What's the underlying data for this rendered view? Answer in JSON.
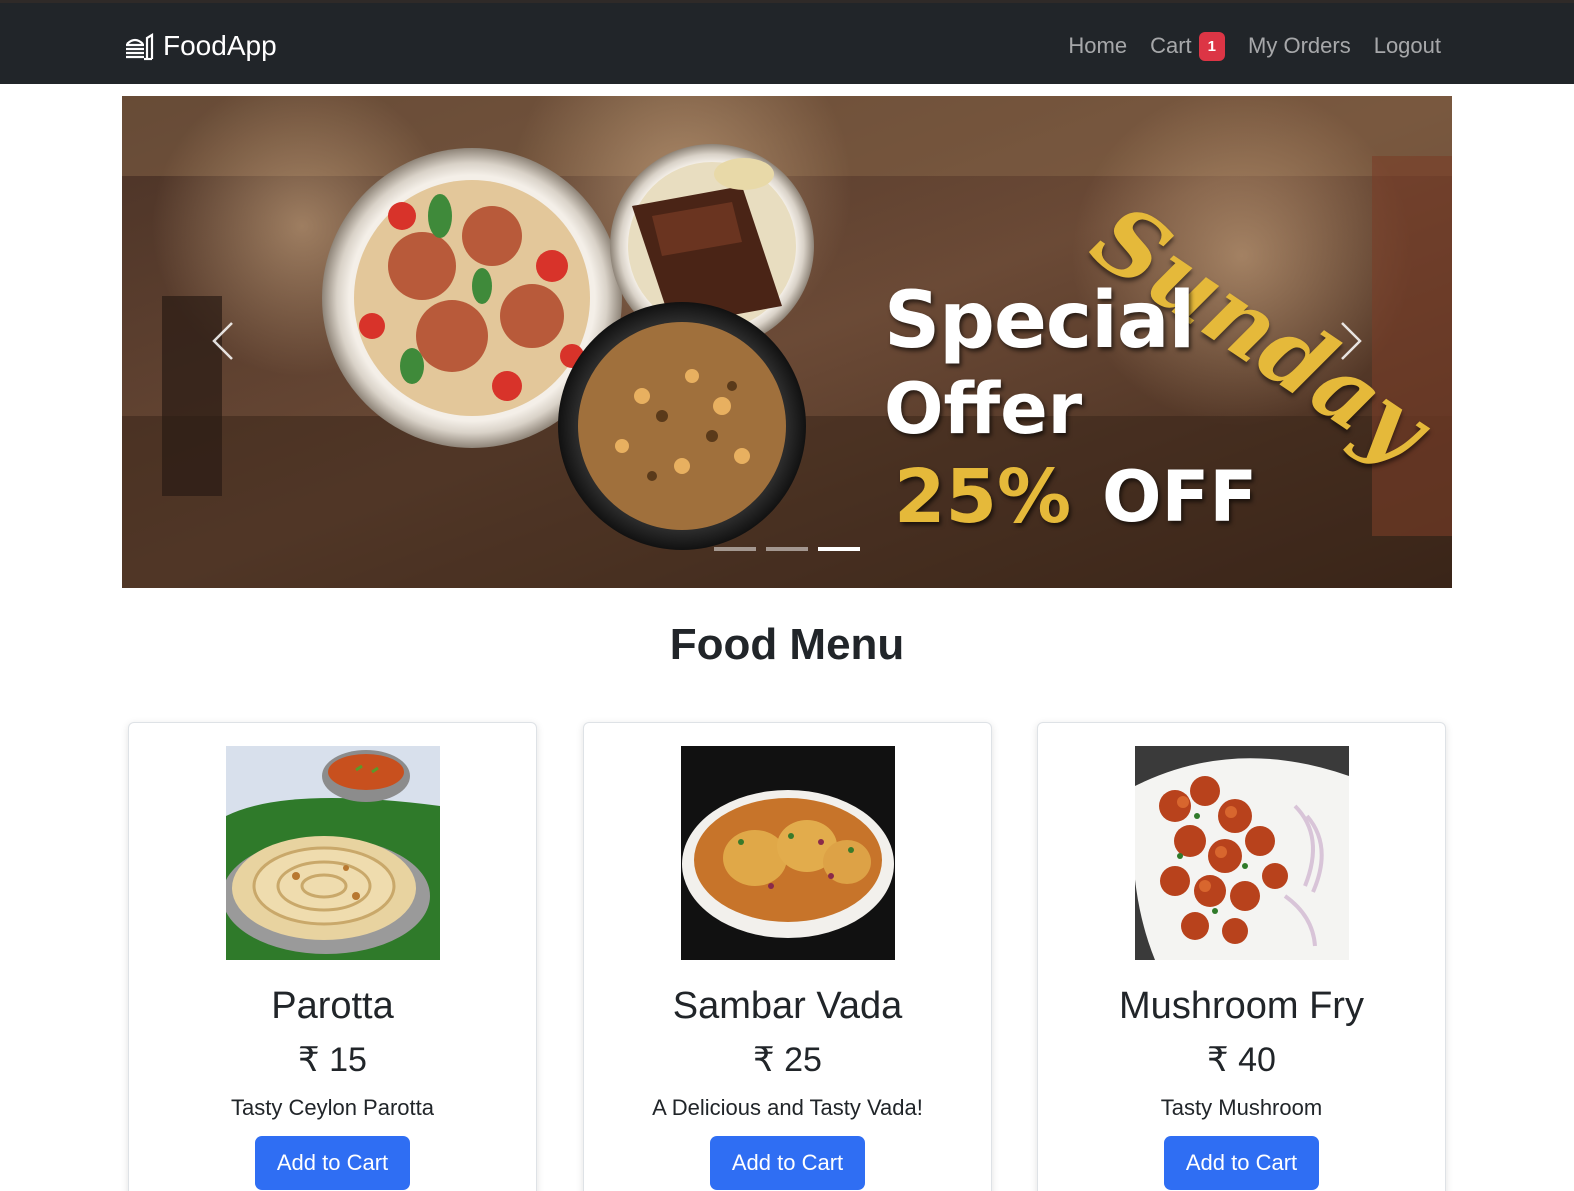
{
  "navbar": {
    "brand": "FoodApp",
    "brand_icon": "hamburger-food-icon",
    "links": [
      {
        "label": "Home"
      },
      {
        "label": "Cart",
        "badge": "1"
      },
      {
        "label": "My Orders"
      },
      {
        "label": "Logout"
      }
    ]
  },
  "carousel": {
    "headline_script": "Sunday",
    "headline_1": "Special",
    "headline_2": "Offer",
    "discount": "25%",
    "discount_suffix": "OFF",
    "prev_icon": "chevron-left-icon",
    "next_icon": "chevron-right-icon",
    "slide_count": 3,
    "active_slide": 3
  },
  "menu": {
    "title": "Food Menu",
    "items": [
      {
        "name": "Parotta",
        "price": "₹ 15",
        "description": "Tasty Ceylon Parotta",
        "button": "Add to Cart"
      },
      {
        "name": "Sambar Vada",
        "price": "₹ 25",
        "description": "A Delicious and Tasty Vada!",
        "button": "Add to Cart"
      },
      {
        "name": "Mushroom Fry",
        "price": "₹ 40",
        "description": "Tasty Mushroom",
        "button": "Add to Cart"
      }
    ]
  },
  "colors": {
    "navbar_bg": "#212529",
    "badge": "#dc3545",
    "primary_button": "#2f6ef3",
    "promo_gold": "#e5b93a"
  }
}
